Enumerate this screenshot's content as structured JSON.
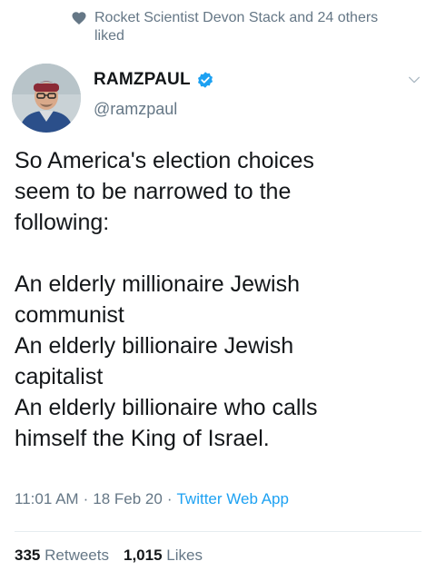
{
  "social_context": {
    "icon": "heart-icon",
    "text": "Rocket Scientist Devon Stack and 24 others liked"
  },
  "author": {
    "display_name": "RAMZPAUL",
    "handle": "@ramzpaul",
    "verified": true
  },
  "tweet": {
    "lines": [
      "So America's election choices",
      "seem to be narrowed to the",
      "following:",
      "",
      "An elderly millionaire Jewish",
      "communist",
      "An elderly billionaire Jewish",
      "capitalist",
      "An elderly billionaire who calls",
      "himself the King of Israel."
    ],
    "time": "11:01 AM",
    "date": "18 Feb 20",
    "source": "Twitter Web App",
    "separator": "·"
  },
  "stats": {
    "retweets_count": "335",
    "retweets_label": "Retweets",
    "likes_count": "1,015",
    "likes_label": "Likes"
  },
  "colors": {
    "text": "#14171a",
    "muted": "#657786",
    "link": "#1da1f2",
    "divider": "#e6ecf0"
  }
}
